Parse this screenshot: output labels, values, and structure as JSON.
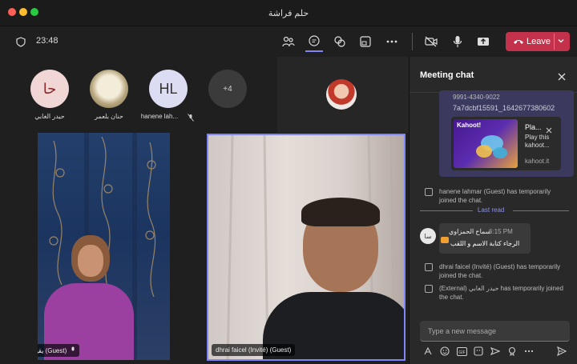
{
  "window": {
    "title": "حلم فراشة"
  },
  "toolbar": {
    "timer": "23:48",
    "leave_label": "Leave"
  },
  "participants": [
    {
      "initials": "حا",
      "name": "حيدر الغابي",
      "bg": "#f1d6d6",
      "fg": "#8b2a2a"
    },
    {
      "initials": "",
      "name": "حنان بلعمر",
      "bg": "#d8cfb8",
      "fg": "#333"
    },
    {
      "initials": "HL",
      "name": "hanene lah...",
      "bg": "#dcdcf3",
      "fg": "#333"
    },
    {
      "initials": "+4",
      "name": "",
      "bg": "#3b3b3b",
      "fg": "#ccc"
    }
  ],
  "videos": {
    "left_label": "يقين النوري (Guest)",
    "right_label": "dhrai faicel (Invité) (Guest)"
  },
  "chat": {
    "header": "Meeting chat",
    "link_text": "7a7dcbf15591_1642677380602",
    "link_partial": "9991-4340-9022",
    "card": {
      "brand": "Kahoot!",
      "title": "Pla...",
      "desc": "Play this kahoot...",
      "url": "kahoot.it"
    },
    "sys1": "hanene lahmar (Guest) has temporarily joined the chat.",
    "last_read": "Last read",
    "msg": {
      "author": "سماح الحمزاوي",
      "time": "6:15 PM",
      "text": "الرجاء كتابة الاسم و اللقب",
      "initials": "سا"
    },
    "sys2": "dhrai faicel (Invité) (Guest) has temporarily joined the chat.",
    "sys3": "(External) حيدر الغابي has temporarily joined the chat.",
    "input_placeholder": "Type a new message"
  },
  "colors": {
    "accent": "#7f85f5",
    "leave": "#c4314b"
  }
}
